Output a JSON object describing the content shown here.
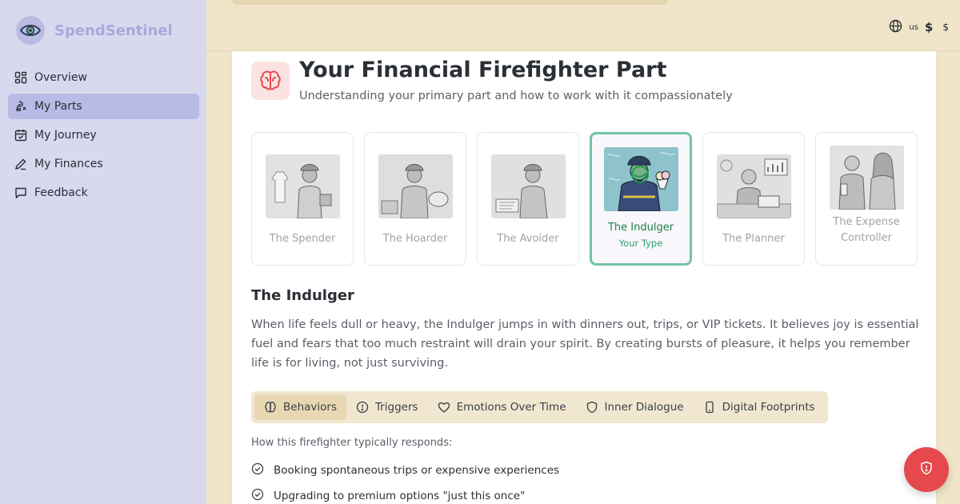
{
  "app": {
    "name": "SpendSentinel"
  },
  "sidebar": {
    "items": [
      {
        "label": "Overview",
        "icon": "grid-icon"
      },
      {
        "label": "My Parts",
        "icon": "parts-icon",
        "active": true
      },
      {
        "label": "My Journey",
        "icon": "calendar-icon"
      },
      {
        "label": "My Finances",
        "icon": "pen-icon"
      },
      {
        "label": "Feedback",
        "icon": "chat-icon"
      }
    ]
  },
  "header": {
    "locale": "us",
    "currency_symbol": "$",
    "currency_code": "$"
  },
  "page": {
    "title": "Your Financial Firefighter Part",
    "subtitle": "Understanding your primary part and how to work with it compassionately"
  },
  "parts": [
    {
      "label": "The Spender"
    },
    {
      "label": "The Hoarder"
    },
    {
      "label": "The Avoider"
    },
    {
      "label": "The Indulger",
      "sub": "Your Type",
      "selected": true
    },
    {
      "label": "The Planner"
    },
    {
      "label": "The Expense Controller"
    }
  ],
  "detail": {
    "title": "The Indulger",
    "description": "When life feels dull or heavy, the Indulger jumps in with dinners out, trips, or VIP tickets. It believes joy is essential fuel and fears that too much restraint will drain your spirit. By creating bursts of pleasure, it helps you remember life is for living, not just surviving."
  },
  "tabs": [
    {
      "label": "Behaviors",
      "icon": "brain-icon",
      "active": true
    },
    {
      "label": "Triggers",
      "icon": "alert-icon"
    },
    {
      "label": "Emotions Over Time",
      "icon": "heart-icon"
    },
    {
      "label": "Inner Dialogue",
      "icon": "shield-icon"
    },
    {
      "label": "Digital Footprints",
      "icon": "phone-icon"
    }
  ],
  "behaviors": {
    "intro": "How this firefighter typically responds:",
    "items": [
      "Booking spontaneous trips or expensive experiences",
      "Upgrading to premium options \"just this once\""
    ]
  },
  "colors": {
    "sidebar_bg": "#d8d8ee",
    "active_nav": "#b9bbe7",
    "page_bg": "#f0e5c9",
    "selected_border": "#72c4a3",
    "selected_text": "#1d7f48",
    "fab": "#e5484d"
  }
}
